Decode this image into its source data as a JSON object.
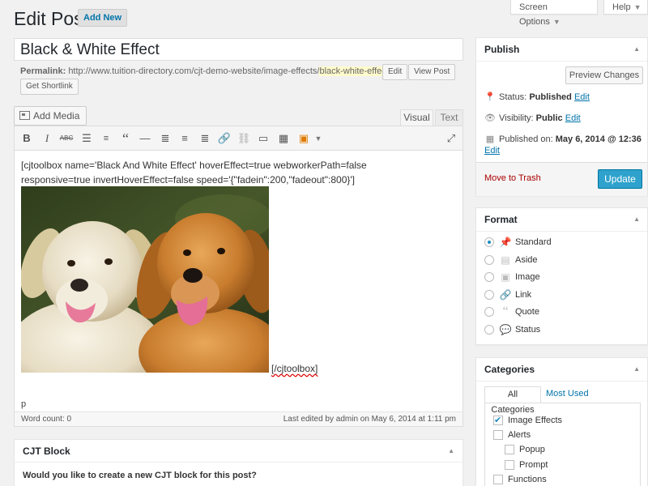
{
  "header": {
    "title": "Edit Post",
    "add_new_label": "Add New",
    "screen_options_label": "Screen Options",
    "help_label": "Help"
  },
  "post": {
    "title": "Black & White Effect",
    "permalink_label": "Permalink:",
    "permalink_base": "http://www.tuition-directory.com/cjt-demo-website/image-effects/",
    "permalink_slug": "black-white-effect",
    "permalink_trail": "/",
    "edit_slug_label": "Edit",
    "view_post_label": "View Post",
    "get_shortlink_label": "Get Shortlink"
  },
  "editor": {
    "add_media_label": "Add Media",
    "tab_visual": "Visual",
    "tab_text": "Text",
    "content_line1": "[cjtoolbox name='Black And White Effect' hoverEffect=true webworkerPath=false",
    "content_line2": "responsive=true invertHoverEffect=false speed='{\"fadein\":200,\"fadeout\":800}']",
    "closing_tag": "[/cjtoolbox]",
    "path": "p",
    "word_count": "Word count: 0",
    "last_edited": "Last edited by admin on May 6, 2014 at 1:11 pm",
    "toolbar_icons": [
      "bold-icon",
      "italic-icon",
      "strikethrough-icon",
      "bullet-list-icon",
      "numbered-list-icon",
      "blockquote-icon",
      "horizontal-rule-icon",
      "align-left-icon",
      "align-center-icon",
      "align-right-icon",
      "link-icon",
      "unlink-icon",
      "read-more-icon",
      "toolbar-toggle-icon",
      "cjt-icon",
      "fullscreen-icon"
    ]
  },
  "cjt_block": {
    "title": "CJT Block",
    "question": "Would you like to create a new CJT block for this post?"
  },
  "publish": {
    "title": "Publish",
    "preview_label": "Preview Changes",
    "status_label": "Status:",
    "status_value": "Published",
    "visibility_label": "Visibility:",
    "visibility_value": "Public",
    "published_label": "Published on:",
    "published_value": "May 6, 2014 @ 12:36",
    "edit_label": "Edit",
    "trash_label": "Move to Trash",
    "update_label": "Update"
  },
  "format": {
    "title": "Format",
    "selected": "Standard",
    "options": [
      "Standard",
      "Aside",
      "Image",
      "Link",
      "Quote",
      "Status"
    ]
  },
  "categories": {
    "title": "Categories",
    "tab_all": "All Categories",
    "tab_most_used": "Most Used",
    "items": [
      {
        "label": "Image Effects",
        "checked": true,
        "level": 0
      },
      {
        "label": "Alerts",
        "checked": false,
        "level": 0
      },
      {
        "label": "Popup",
        "checked": false,
        "level": 1
      },
      {
        "label": "Prompt",
        "checked": false,
        "level": 1
      },
      {
        "label": "Functions",
        "checked": false,
        "level": 0
      }
    ]
  },
  "colors": {
    "link": "#0073aa",
    "primary_button": "#2ea2cc",
    "trash": "#a00000",
    "slug_highlight": "#fffbcc"
  }
}
